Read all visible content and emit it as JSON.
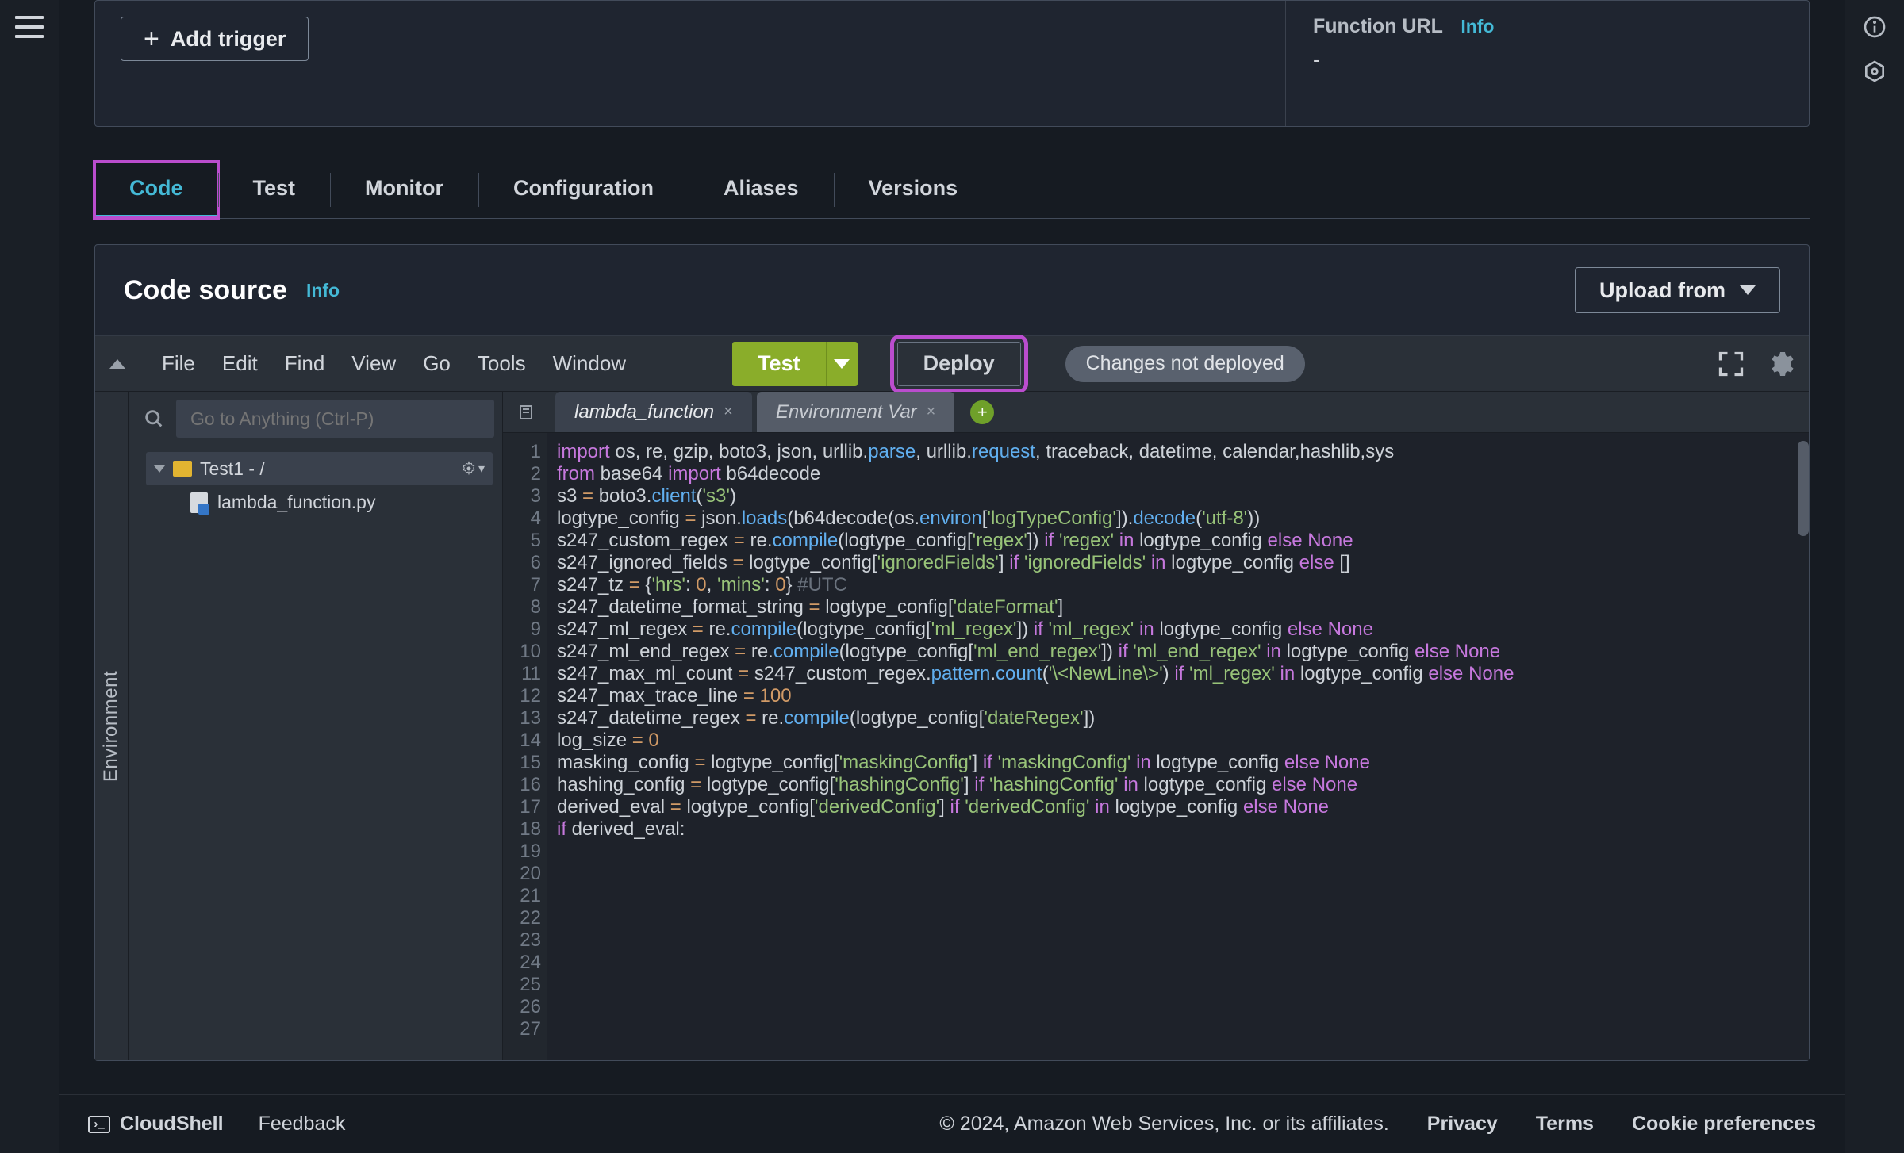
{
  "overview": {
    "add_trigger_label": "Add trigger",
    "function_url_label": "Function URL",
    "info_label": "Info",
    "function_url_value": "-"
  },
  "tabs": {
    "items": [
      "Code",
      "Test",
      "Monitor",
      "Configuration",
      "Aliases",
      "Versions"
    ],
    "active": "Code"
  },
  "code_source": {
    "title": "Code source",
    "info_label": "Info",
    "upload_from_label": "Upload from"
  },
  "ide": {
    "menu": [
      "File",
      "Edit",
      "Find",
      "View",
      "Go",
      "Tools",
      "Window"
    ],
    "test_label": "Test",
    "deploy_label": "Deploy",
    "status_chip": "Changes not deployed",
    "search_placeholder": "Go to Anything (Ctrl-P)",
    "env_label": "Environment",
    "tree_root": "Test1 - /",
    "tree_file": "lambda_function.py",
    "editor_tabs": {
      "active": "lambda_function",
      "inactive": "Environment Var",
      "add_tip": "New tab"
    }
  },
  "code": {
    "lines": [
      {
        "n": 1,
        "tokens": [
          [
            "kw",
            "import"
          ],
          [
            "id",
            " os, re, gzip, boto3, json, urllib."
          ],
          [
            "fn",
            "parse"
          ],
          [
            "id",
            ", urllib."
          ],
          [
            "fn",
            "request"
          ],
          [
            "id",
            ", traceback, datetime, calendar,hashlib,sys"
          ]
        ]
      },
      {
        "n": 2,
        "tokens": [
          [
            "kw",
            "from"
          ],
          [
            "id",
            " base64 "
          ],
          [
            "kw",
            "import"
          ],
          [
            "id",
            " b64decode"
          ]
        ]
      },
      {
        "n": 3,
        "tokens": [
          [
            "id",
            ""
          ]
        ]
      },
      {
        "n": 4,
        "tokens": [
          [
            "id",
            "s3 "
          ],
          [
            "op",
            "="
          ],
          [
            "id",
            " boto3."
          ],
          [
            "fn",
            "client"
          ],
          [
            "id",
            "("
          ],
          [
            "str",
            "'s3'"
          ],
          [
            "id",
            ")"
          ]
        ]
      },
      {
        "n": 5,
        "tokens": [
          [
            "id",
            ""
          ]
        ]
      },
      {
        "n": 6,
        "tokens": [
          [
            "id",
            "logtype_config "
          ],
          [
            "op",
            "="
          ],
          [
            "id",
            " json."
          ],
          [
            "fn",
            "loads"
          ],
          [
            "id",
            "(b64decode(os."
          ],
          [
            "fn",
            "environ"
          ],
          [
            "id",
            "["
          ],
          [
            "str",
            "'logTypeConfig'"
          ],
          [
            "id",
            "])."
          ],
          [
            "fn",
            "decode"
          ],
          [
            "id",
            "("
          ],
          [
            "str",
            "'utf-8'"
          ],
          [
            "id",
            "))"
          ]
        ]
      },
      {
        "n": 7,
        "tokens": [
          [
            "id",
            ""
          ]
        ]
      },
      {
        "n": 8,
        "tokens": [
          [
            "id",
            "s247_custom_regex "
          ],
          [
            "op",
            "="
          ],
          [
            "id",
            " re."
          ],
          [
            "fn",
            "compile"
          ],
          [
            "id",
            "(logtype_config["
          ],
          [
            "str",
            "'regex'"
          ],
          [
            "id",
            "]) "
          ],
          [
            "kw",
            "if"
          ],
          [
            "id",
            " "
          ],
          [
            "str",
            "'regex'"
          ],
          [
            "id",
            " "
          ],
          [
            "kw",
            "in"
          ],
          [
            "id",
            " logtype_config "
          ],
          [
            "kw",
            "else"
          ],
          [
            "id",
            " "
          ],
          [
            "kw2",
            "None"
          ]
        ]
      },
      {
        "n": 9,
        "tokens": [
          [
            "id",
            ""
          ]
        ]
      },
      {
        "n": 10,
        "tokens": [
          [
            "id",
            "s247_ignored_fields "
          ],
          [
            "op",
            "="
          ],
          [
            "id",
            " logtype_config["
          ],
          [
            "str",
            "'ignoredFields'"
          ],
          [
            "id",
            "] "
          ],
          [
            "kw",
            "if"
          ],
          [
            "id",
            " "
          ],
          [
            "str",
            "'ignoredFields'"
          ],
          [
            "id",
            " "
          ],
          [
            "kw",
            "in"
          ],
          [
            "id",
            " logtype_config "
          ],
          [
            "kw",
            "else"
          ],
          [
            "id",
            " []"
          ]
        ]
      },
      {
        "n": 11,
        "tokens": [
          [
            "id",
            ""
          ]
        ]
      },
      {
        "n": 12,
        "tokens": [
          [
            "id",
            "s247_tz "
          ],
          [
            "op",
            "="
          ],
          [
            "id",
            " {"
          ],
          [
            "str",
            "'hrs'"
          ],
          [
            "id",
            ": "
          ],
          [
            "num",
            "0"
          ],
          [
            "id",
            ", "
          ],
          [
            "str",
            "'mins'"
          ],
          [
            "id",
            ": "
          ],
          [
            "num",
            "0"
          ],
          [
            "id",
            "} "
          ],
          [
            "cmt",
            "#UTC"
          ]
        ]
      },
      {
        "n": 13,
        "tokens": [
          [
            "id",
            ""
          ]
        ]
      },
      {
        "n": 14,
        "tokens": [
          [
            "id",
            "s247_datetime_format_string "
          ],
          [
            "op",
            "="
          ],
          [
            "id",
            " logtype_config["
          ],
          [
            "str",
            "'dateFormat'"
          ],
          [
            "id",
            "]"
          ]
        ]
      },
      {
        "n": 15,
        "tokens": [
          [
            "id",
            "s247_ml_regex "
          ],
          [
            "op",
            "="
          ],
          [
            "id",
            " re."
          ],
          [
            "fn",
            "compile"
          ],
          [
            "id",
            "(logtype_config["
          ],
          [
            "str",
            "'ml_regex'"
          ],
          [
            "id",
            "]) "
          ],
          [
            "kw",
            "if"
          ],
          [
            "id",
            " "
          ],
          [
            "str",
            "'ml_regex'"
          ],
          [
            "id",
            " "
          ],
          [
            "kw",
            "in"
          ],
          [
            "id",
            " logtype_config "
          ],
          [
            "kw",
            "else"
          ],
          [
            "id",
            " "
          ],
          [
            "kw2",
            "None"
          ]
        ]
      },
      {
        "n": 16,
        "tokens": [
          [
            "id",
            "s247_ml_end_regex "
          ],
          [
            "op",
            "="
          ],
          [
            "id",
            " re."
          ],
          [
            "fn",
            "compile"
          ],
          [
            "id",
            "(logtype_config["
          ],
          [
            "str",
            "'ml_end_regex'"
          ],
          [
            "id",
            "]) "
          ],
          [
            "kw",
            "if"
          ],
          [
            "id",
            " "
          ],
          [
            "str",
            "'ml_end_regex'"
          ],
          [
            "id",
            " "
          ],
          [
            "kw",
            "in"
          ],
          [
            "id",
            " logtype_config "
          ],
          [
            "kw",
            "else"
          ],
          [
            "id",
            " "
          ],
          [
            "kw2",
            "None"
          ]
        ]
      },
      {
        "n": 17,
        "tokens": [
          [
            "id",
            "s247_max_ml_count "
          ],
          [
            "op",
            "="
          ],
          [
            "id",
            " s247_custom_regex."
          ],
          [
            "fn",
            "pattern"
          ],
          [
            "id",
            "."
          ],
          [
            "fn",
            "count"
          ],
          [
            "id",
            "("
          ],
          [
            "str",
            "'\\<NewLine\\>'"
          ],
          [
            "id",
            ") "
          ],
          [
            "kw",
            "if"
          ],
          [
            "id",
            " "
          ],
          [
            "str",
            "'ml_regex'"
          ],
          [
            "id",
            " "
          ],
          [
            "kw",
            "in"
          ],
          [
            "id",
            " logtype_config "
          ],
          [
            "kw",
            "else"
          ],
          [
            "id",
            " "
          ],
          [
            "kw2",
            "None"
          ]
        ]
      },
      {
        "n": 18,
        "tokens": [
          [
            "id",
            "s247_max_trace_line "
          ],
          [
            "op",
            "="
          ],
          [
            "id",
            " "
          ],
          [
            "num",
            "100"
          ]
        ]
      },
      {
        "n": 19,
        "tokens": [
          [
            "id",
            "s247_datetime_regex "
          ],
          [
            "op",
            "="
          ],
          [
            "id",
            " re."
          ],
          [
            "fn",
            "compile"
          ],
          [
            "id",
            "(logtype_config["
          ],
          [
            "str",
            "'dateRegex'"
          ],
          [
            "id",
            "])"
          ]
        ]
      },
      {
        "n": 20,
        "tokens": [
          [
            "id",
            ""
          ]
        ]
      },
      {
        "n": 21,
        "tokens": [
          [
            "id",
            "log_size "
          ],
          [
            "op",
            "="
          ],
          [
            "id",
            " "
          ],
          [
            "num",
            "0"
          ]
        ]
      },
      {
        "n": 22,
        "tokens": [
          [
            "id",
            ""
          ]
        ]
      },
      {
        "n": 23,
        "tokens": [
          [
            "id",
            "masking_config "
          ],
          [
            "op",
            "="
          ],
          [
            "id",
            " logtype_config["
          ],
          [
            "str",
            "'maskingConfig'"
          ],
          [
            "id",
            "] "
          ],
          [
            "kw",
            "if"
          ],
          [
            "id",
            " "
          ],
          [
            "str",
            "'maskingConfig'"
          ],
          [
            "id",
            " "
          ],
          [
            "kw",
            "in"
          ],
          [
            "id",
            " logtype_config "
          ],
          [
            "kw",
            "else"
          ],
          [
            "id",
            " "
          ],
          [
            "kw2",
            "None"
          ]
        ]
      },
      {
        "n": 24,
        "tokens": [
          [
            "id",
            "hashing_config "
          ],
          [
            "op",
            "="
          ],
          [
            "id",
            " logtype_config["
          ],
          [
            "str",
            "'hashingConfig'"
          ],
          [
            "id",
            "] "
          ],
          [
            "kw",
            "if"
          ],
          [
            "id",
            " "
          ],
          [
            "str",
            "'hashingConfig'"
          ],
          [
            "id",
            " "
          ],
          [
            "kw",
            "in"
          ],
          [
            "id",
            " logtype_config "
          ],
          [
            "kw",
            "else"
          ],
          [
            "id",
            " "
          ],
          [
            "kw2",
            "None"
          ]
        ]
      },
      {
        "n": 25,
        "tokens": [
          [
            "id",
            "derived_eval "
          ],
          [
            "op",
            "="
          ],
          [
            "id",
            " logtype_config["
          ],
          [
            "str",
            "'derivedConfig'"
          ],
          [
            "id",
            "] "
          ],
          [
            "kw",
            "if"
          ],
          [
            "id",
            " "
          ],
          [
            "str",
            "'derivedConfig'"
          ],
          [
            "id",
            " "
          ],
          [
            "kw",
            "in"
          ],
          [
            "id",
            " logtype_config "
          ],
          [
            "kw",
            "else"
          ],
          [
            "id",
            " "
          ],
          [
            "kw2",
            "None"
          ]
        ]
      },
      {
        "n": 26,
        "tokens": [
          [
            "id",
            ""
          ]
        ]
      },
      {
        "n": 27,
        "tokens": [
          [
            "kw",
            "if"
          ],
          [
            "id",
            " derived_eval:"
          ]
        ]
      }
    ]
  },
  "footer": {
    "cloudshell": "CloudShell",
    "feedback": "Feedback",
    "copyright": "© 2024, Amazon Web Services, Inc. or its affiliates.",
    "links": [
      "Privacy",
      "Terms",
      "Cookie preferences"
    ]
  }
}
